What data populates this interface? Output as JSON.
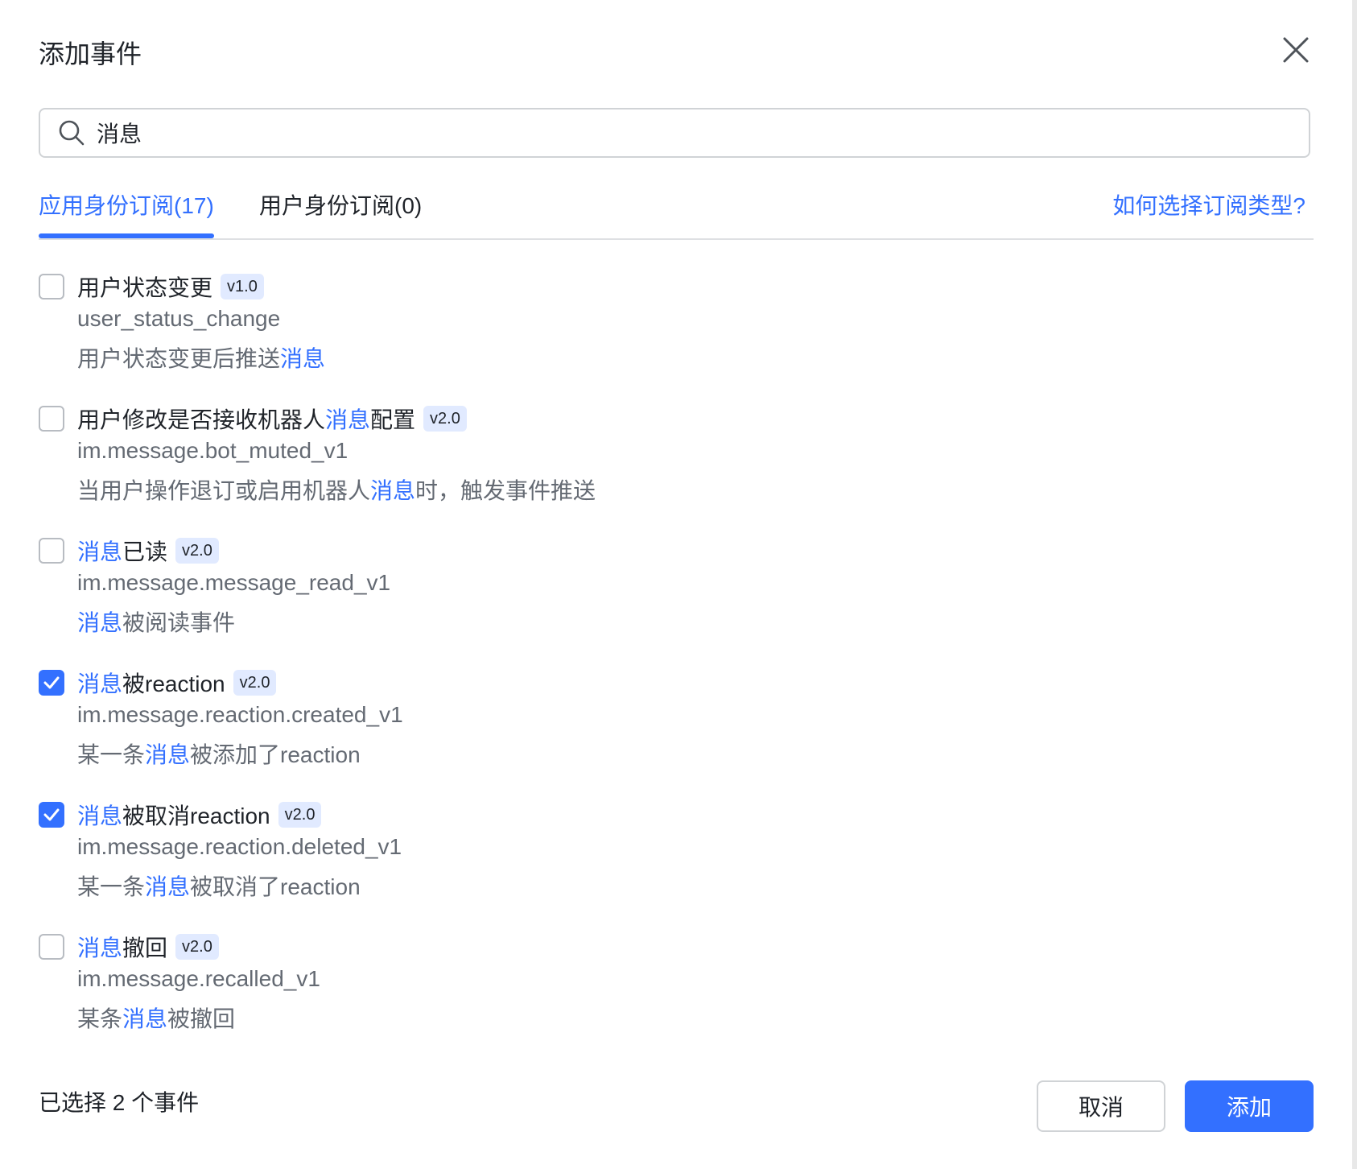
{
  "dialog": {
    "title": "添加事件"
  },
  "search": {
    "value": "消息",
    "icon": "search-icon"
  },
  "tabs": [
    {
      "label": "应用身份订阅(17)",
      "active": true
    },
    {
      "label": "用户身份订阅(0)",
      "active": false
    }
  ],
  "help_link": "如何选择订阅类型?",
  "accent_color": "#3370ff",
  "events": [
    {
      "title_parts": [
        {
          "t": "用户状态变更",
          "hl": false
        }
      ],
      "version": "v1.0",
      "key": "user_status_change",
      "desc_parts": [
        {
          "t": "用户状态变更后推送",
          "hl": false
        },
        {
          "t": "消息",
          "hl": true
        }
      ],
      "checked": false
    },
    {
      "title_parts": [
        {
          "t": "用户修改是否接收机器人",
          "hl": false
        },
        {
          "t": "消息",
          "hl": true
        },
        {
          "t": "配置",
          "hl": false
        }
      ],
      "version": "v2.0",
      "key": "im.message.bot_muted_v1",
      "desc_parts": [
        {
          "t": "当用户操作退订或启用机器人",
          "hl": false
        },
        {
          "t": "消息",
          "hl": true
        },
        {
          "t": "时，触发事件推送",
          "hl": false
        }
      ],
      "checked": false
    },
    {
      "title_parts": [
        {
          "t": "消息",
          "hl": true
        },
        {
          "t": "已读",
          "hl": false
        }
      ],
      "version": "v2.0",
      "key": "im.message.message_read_v1",
      "desc_parts": [
        {
          "t": "消息",
          "hl": true
        },
        {
          "t": "被阅读事件",
          "hl": false
        }
      ],
      "checked": false
    },
    {
      "title_parts": [
        {
          "t": "消息",
          "hl": true
        },
        {
          "t": "被reaction",
          "hl": false
        }
      ],
      "version": "v2.0",
      "key": "im.message.reaction.created_v1",
      "desc_parts": [
        {
          "t": "某一条",
          "hl": false
        },
        {
          "t": "消息",
          "hl": true
        },
        {
          "t": "被添加了reaction",
          "hl": false
        }
      ],
      "checked": true
    },
    {
      "title_parts": [
        {
          "t": "消息",
          "hl": true
        },
        {
          "t": "被取消reaction",
          "hl": false
        }
      ],
      "version": "v2.0",
      "key": "im.message.reaction.deleted_v1",
      "desc_parts": [
        {
          "t": "某一条",
          "hl": false
        },
        {
          "t": "消息",
          "hl": true
        },
        {
          "t": "被取消了reaction",
          "hl": false
        }
      ],
      "checked": true
    },
    {
      "title_parts": [
        {
          "t": "消息",
          "hl": true
        },
        {
          "t": "撤回",
          "hl": false
        }
      ],
      "version": "v2.0",
      "key": "im.message.recalled_v1",
      "desc_parts": [
        {
          "t": "某条",
          "hl": false
        },
        {
          "t": "消息",
          "hl": true
        },
        {
          "t": "被撤回",
          "hl": false
        }
      ],
      "checked": false
    }
  ],
  "footer": {
    "selected_text": "已选择 2 个事件",
    "cancel_label": "取消",
    "add_label": "添加"
  }
}
